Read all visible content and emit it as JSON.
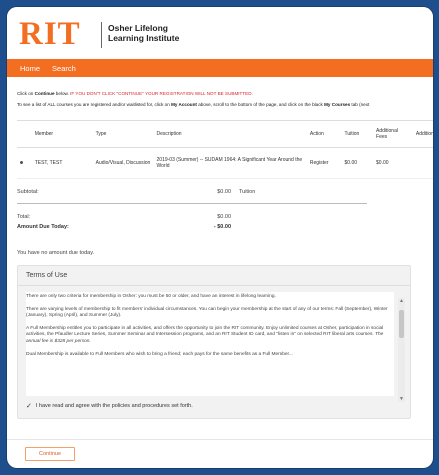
{
  "header": {
    "logo_text": "RIT",
    "logo_subtitle_line1": "Osher Lifelong",
    "logo_subtitle_line2": "Learning Institute"
  },
  "nav": {
    "items": [
      "Home",
      "Search"
    ]
  },
  "notices": {
    "line1_prefix": "Click on ",
    "line1_bold": "Continue",
    "line1_middle": " below. ",
    "line1_red": "IF YOU DON'T CLICK \"CONTINUE\" YOUR REGISTRATION WILL NOT BE SUBMITTED.",
    "line2_prefix": "To see a list of ALL courses you are registered and/or waitlisted for, click on ",
    "line2_bold": "My Account",
    "line2_middle": " above, scroll to the bottom of the page, and click on the black ",
    "line2_bold2": "My Courses",
    "line2_suffix": " tab (next"
  },
  "table": {
    "headers": [
      "",
      "Member",
      "Type",
      "Description",
      "Action",
      "Tuition",
      "Additional Fees",
      "Additional Items"
    ],
    "rows": [
      {
        "member": "TEST, TEST",
        "type": "Audio/Visual, Discussion",
        "description": "2019-03 (Summer) -- SUDAM 1964: A Significant Year Around the World",
        "action": "Register",
        "tuition": "$0.00",
        "fees": "$0.00",
        "items": ""
      }
    ]
  },
  "totals": {
    "subtotal_label": "Subtotal:",
    "subtotal_value": "$0.00",
    "subtotal_note": "Tuition",
    "total_label": "Total:",
    "total_value": "$0.00",
    "due_label": "Amount Due Today:",
    "due_value": "- $0.00",
    "no_amount": "You have no amount due today."
  },
  "terms": {
    "title": "Terms of Use",
    "p1": "There are only two criteria for membership in Osher: you must be 50 or older, and have an interest in lifelong learning.",
    "p2": "There are varying levels of membership to fit members' individual circumstances. You can begin your membership at the start of any of our terms: Fall (September), Winter (January), Spring (April), and Summer (July).",
    "p3a": "A Full Membership entitles you to participate in all activities, and offers the opportunity to join the RIT community. Enjoy unlimited courses at Osher, participation in social activities, the Pfaudler Lecture Series, Summer Seminar and Intersession programs, and an RIT Student ID card, and \"listen in\" on selected RIT liberal arts courses. ",
    "p3b": "The annual fee is $328 per person.",
    "p4": "Dual Membership is available to Full Members who wish to bring a friend; each pays for the same benefits as a Full Member...",
    "agree_text": "I have read and agree with the policies and procedures set forth."
  },
  "buttons": {
    "continue": "Continue"
  },
  "colors": {
    "brand_orange": "#f36e21",
    "frame_blue": "#1f4e8c",
    "notice_red": "#d8262b"
  }
}
